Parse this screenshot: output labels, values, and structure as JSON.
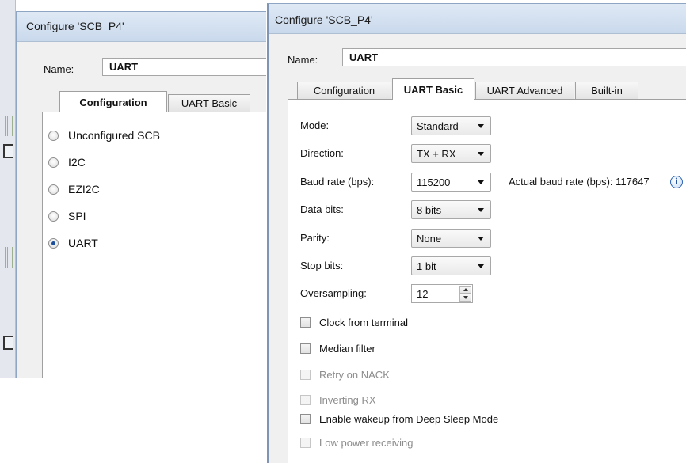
{
  "left_window": {
    "title": "Configure 'SCB_P4'",
    "name_label": "Name:",
    "name_value": "UART",
    "tabs": [
      {
        "label": "Configuration",
        "active": true
      },
      {
        "label": "UART Basic",
        "active": false
      }
    ],
    "radio_options": [
      {
        "label": "Unconfigured SCB",
        "checked": false
      },
      {
        "label": "I2C",
        "checked": false
      },
      {
        "label": "EZI2C",
        "checked": false
      },
      {
        "label": "SPI",
        "checked": false
      },
      {
        "label": "UART",
        "checked": true
      }
    ]
  },
  "right_window": {
    "title": "Configure 'SCB_P4'",
    "name_label": "Name:",
    "name_value": "UART",
    "tabs": [
      {
        "label": "Configuration",
        "active": false
      },
      {
        "label": "UART Basic",
        "active": true
      },
      {
        "label": "UART Advanced",
        "active": false
      },
      {
        "label": "Built-in",
        "active": false
      }
    ],
    "fields": {
      "mode": {
        "label": "Mode:",
        "value": "Standard"
      },
      "direction": {
        "label": "Direction:",
        "value": "TX + RX"
      },
      "baud_rate": {
        "label": "Baud rate (bps):",
        "value": "115200"
      },
      "data_bits": {
        "label": "Data bits:",
        "value": "8 bits"
      },
      "parity": {
        "label": "Parity:",
        "value": "None"
      },
      "stop_bits": {
        "label": "Stop bits:",
        "value": "1 bit"
      },
      "oversampling": {
        "label": "Oversampling:",
        "value": "12"
      }
    },
    "actual_baud_label": "Actual baud rate (bps): 117647",
    "info_glyph": "i",
    "checkboxes": [
      {
        "label": "Clock from terminal",
        "checked": false,
        "enabled": true
      },
      {
        "label": "Median filter",
        "checked": false,
        "enabled": true
      },
      {
        "label": "Retry on NACK",
        "checked": false,
        "enabled": false
      },
      {
        "label": "Inverting RX",
        "checked": false,
        "enabled": false
      },
      {
        "label": "Enable wakeup from Deep Sleep Mode",
        "checked": false,
        "enabled": true
      },
      {
        "label": "Low power receiving",
        "checked": false,
        "enabled": false
      }
    ]
  },
  "icons": {
    "radio": "radio-button",
    "checkbox": "checkbox",
    "dropdown": "chevron-down-icon",
    "info": "info-icon",
    "spinner": "spin-arrows-icon"
  },
  "colors": {
    "title_bar": "#c9d9ec",
    "selected_radio": "#1b4e9b",
    "info_icon": "#2d64b4",
    "disabled_text": "#8d8d8d"
  }
}
